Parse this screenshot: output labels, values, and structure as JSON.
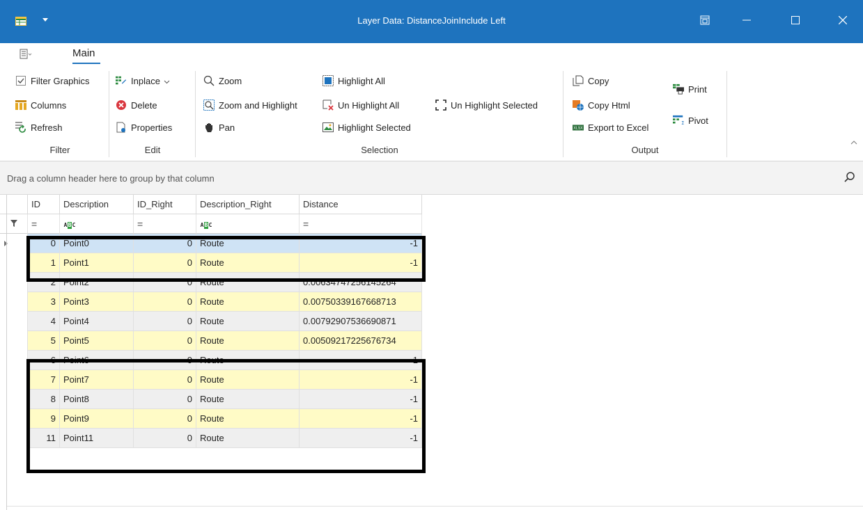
{
  "window": {
    "title": "Layer Data: DistanceJoinInclude Left"
  },
  "ribbon": {
    "tab_main": "Main",
    "filter": {
      "filter_graphics": "Filter Graphics",
      "columns": "Columns",
      "refresh": "Refresh",
      "label": "Filter"
    },
    "edit": {
      "inplace": "Inplace",
      "delete": "Delete",
      "properties": "Properties",
      "label": "Edit"
    },
    "selection": {
      "zoom": "Zoom",
      "zoom_and_highlight": "Zoom and Highlight",
      "pan": "Pan",
      "highlight_all": "Highlight All",
      "un_highlight_all": "Un Highlight All",
      "highlight_selected": "Highlight Selected",
      "un_highlight_selected": "Un Highlight Selected",
      "label": "Selection"
    },
    "output": {
      "copy": "Copy",
      "copy_html": "Copy Html",
      "export_to_excel": "Export to Excel",
      "print": "Print",
      "pivot": "Pivot",
      "label": "Output"
    }
  },
  "group_panel": {
    "hint": "Drag a column header here to group by that column"
  },
  "grid": {
    "columns": [
      "ID",
      "Description",
      "ID_Right",
      "Description_Right",
      "Distance"
    ],
    "filter_row": [
      "=",
      "ABC",
      "=",
      "ABC",
      "="
    ],
    "rows": [
      {
        "id": "0",
        "description": "Point0",
        "id_right": "0",
        "description_right": "Route",
        "distance": "-1"
      },
      {
        "id": "1",
        "description": "Point1",
        "id_right": "0",
        "description_right": "Route",
        "distance": "-1"
      },
      {
        "id": "2",
        "description": "Point2",
        "id_right": "0",
        "description_right": "Route",
        "distance": "0.00634747256145264"
      },
      {
        "id": "3",
        "description": "Point3",
        "id_right": "0",
        "description_right": "Route",
        "distance": "0.00750339167668713"
      },
      {
        "id": "4",
        "description": "Point4",
        "id_right": "0",
        "description_right": "Route",
        "distance": "0.00792907536690871"
      },
      {
        "id": "5",
        "description": "Point5",
        "id_right": "0",
        "description_right": "Route",
        "distance": "0.00509217225676734"
      },
      {
        "id": "6",
        "description": "Point6",
        "id_right": "0",
        "description_right": "Route",
        "distance": "-1"
      },
      {
        "id": "7",
        "description": "Point7",
        "id_right": "0",
        "description_right": "Route",
        "distance": "-1"
      },
      {
        "id": "8",
        "description": "Point8",
        "id_right": "0",
        "description_right": "Route",
        "distance": "-1"
      },
      {
        "id": "9",
        "description": "Point9",
        "id_right": "0",
        "description_right": "Route",
        "distance": "-1"
      },
      {
        "id": "11",
        "description": "Point11",
        "id_right": "0",
        "description_right": "Route",
        "distance": "-1"
      }
    ]
  },
  "colors": {
    "title_bar": "#1e73be",
    "row_even": "#efefef",
    "row_odd": "#fffbc6",
    "row_focused": "#cfe3f5"
  }
}
